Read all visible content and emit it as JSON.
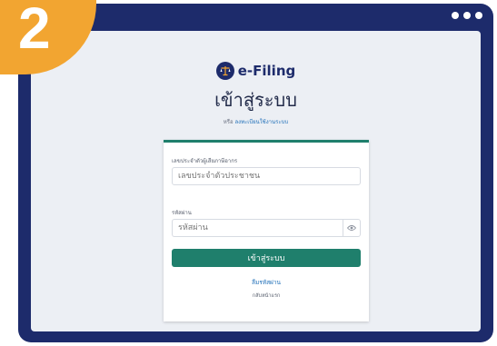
{
  "step_badge": {
    "number": "2",
    "color": "#f2a531"
  },
  "window": {
    "frame_color": "#1d2b6b",
    "controls": [
      "dot",
      "dot",
      "dot"
    ]
  },
  "brand": {
    "logo_icon": "scale-balance-icon",
    "name": "e-Filing"
  },
  "page_title": "เข้าสู่ระบบ",
  "register": {
    "prefix": "หรือ",
    "link": "ลงทะเบียนใช้งานระบบ"
  },
  "form": {
    "id_label": "เลขประจำตัวผู้เสียภาษีอากร",
    "id_placeholder": "เลขประจำตัวประชาชน",
    "password_label": "รหัสผ่าน",
    "password_placeholder": "รหัสผ่าน",
    "show_password_icon": "eye-icon",
    "login_button": "เข้าสู่ระบบ",
    "forgot_password": "ลืมรหัสผ่าน",
    "back_home": "กลับหน้าแรก",
    "accent_color": "#1f7f6c"
  }
}
